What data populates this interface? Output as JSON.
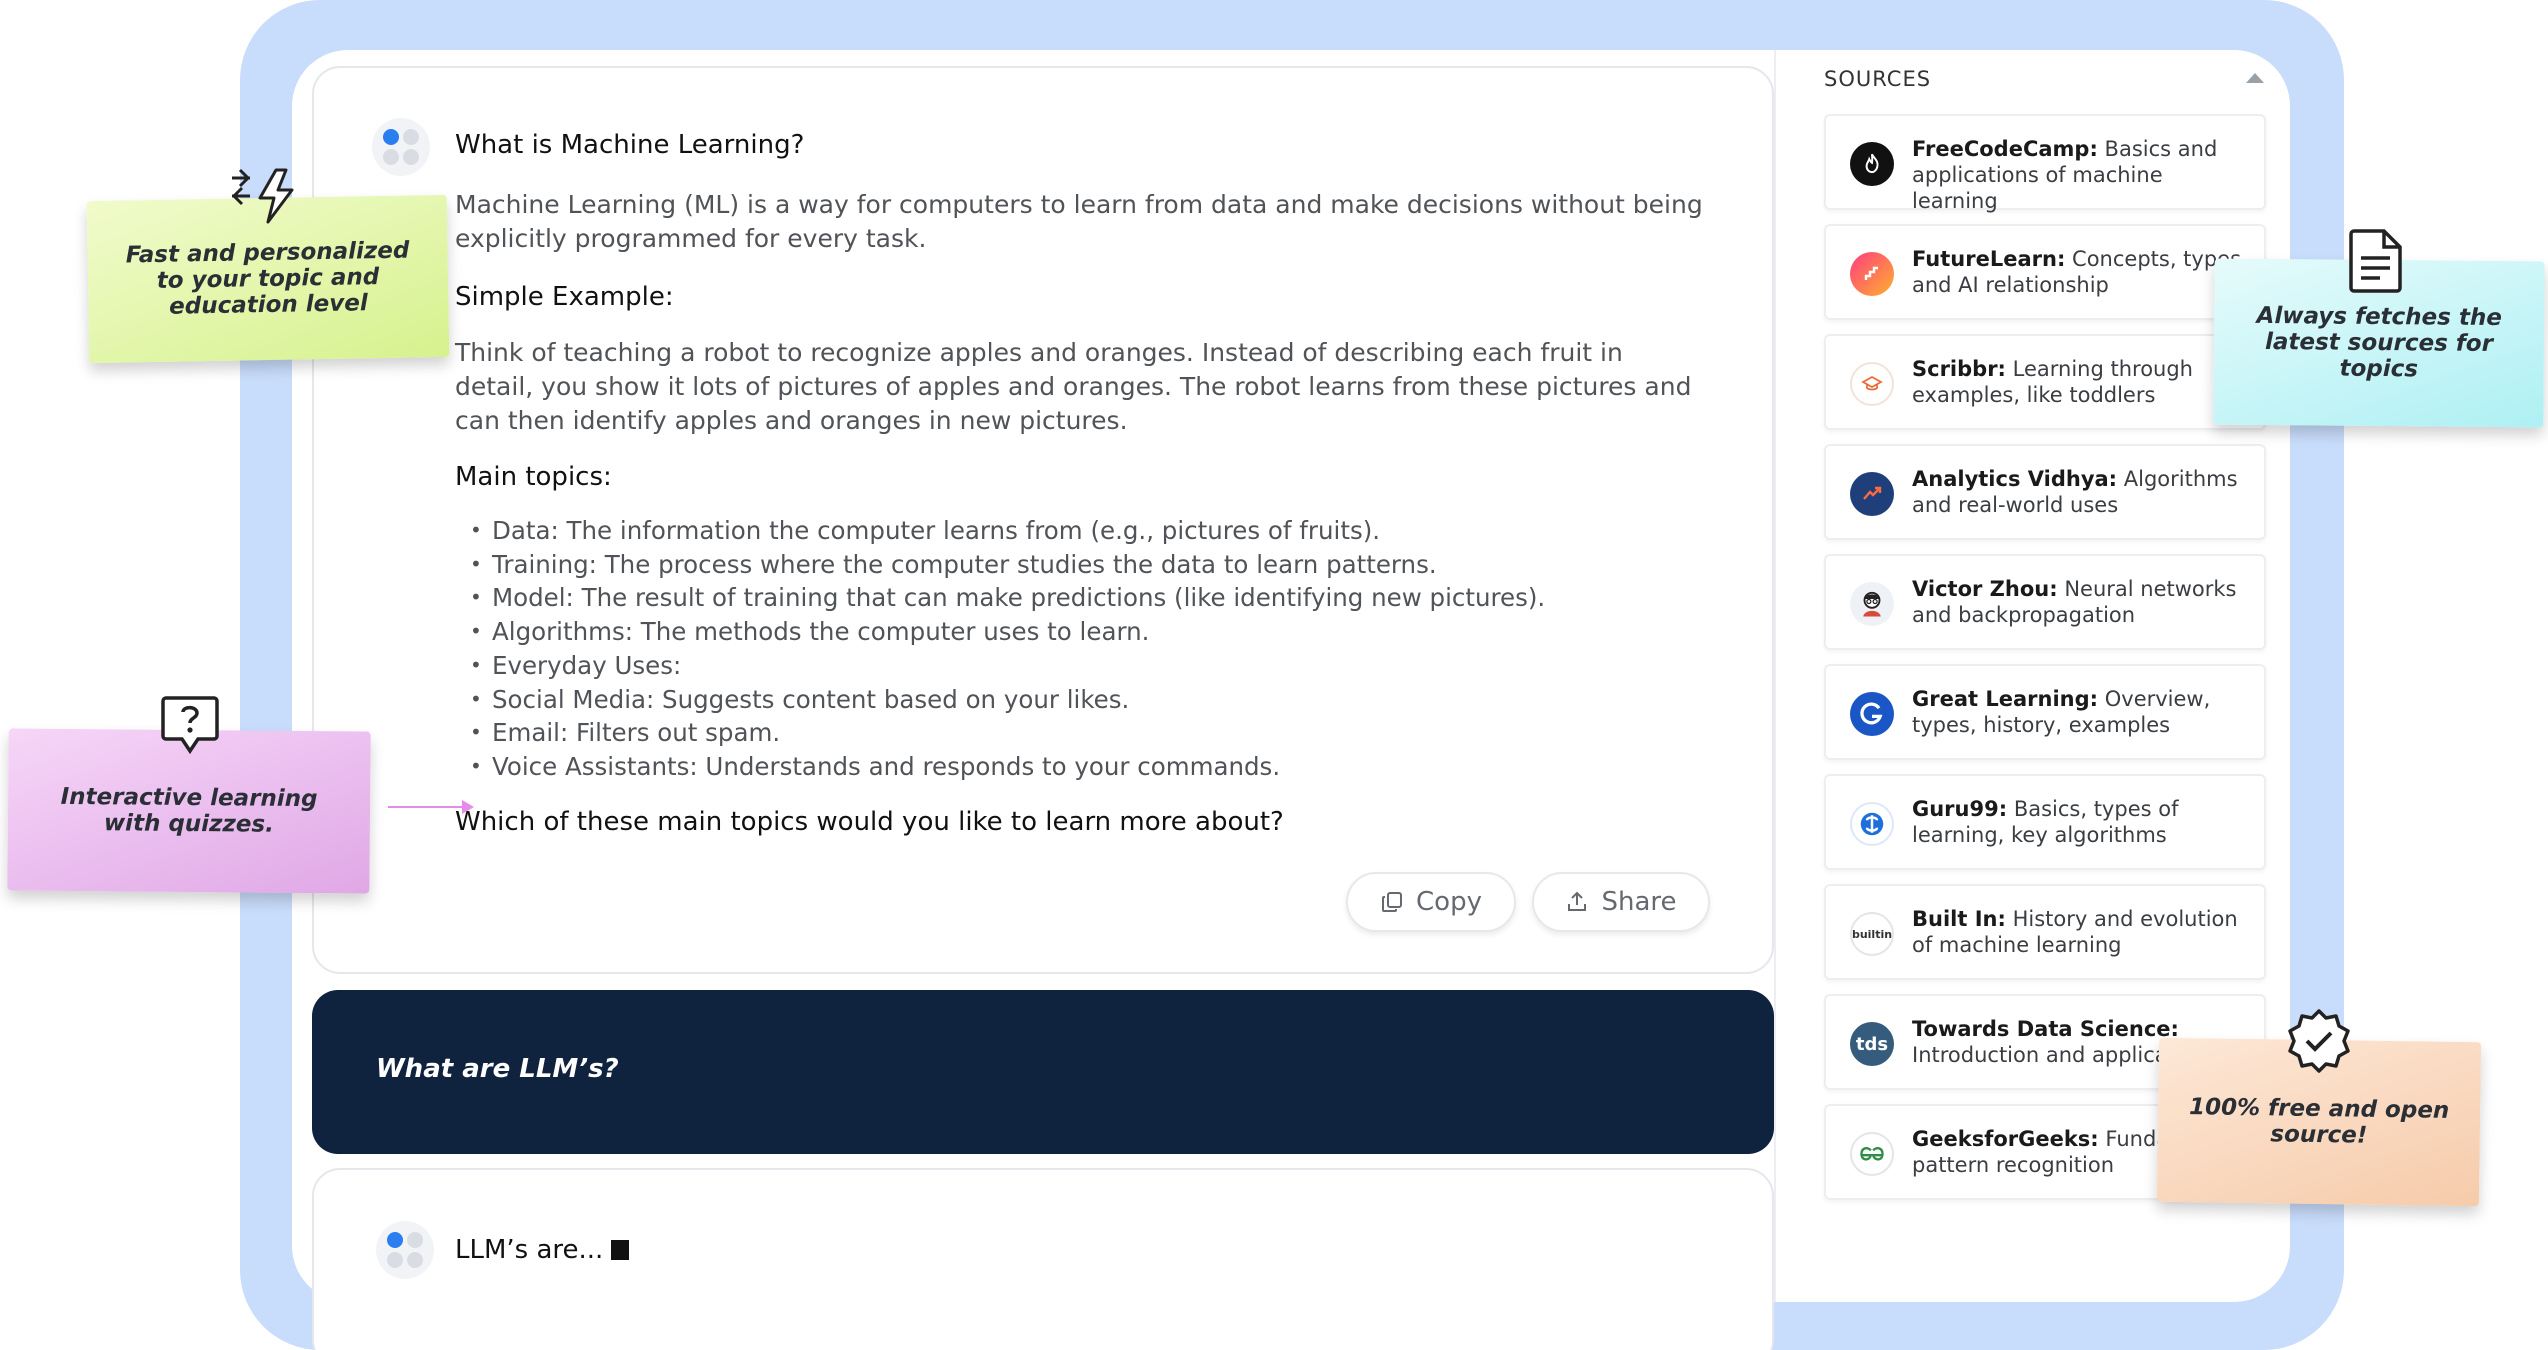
{
  "main": {
    "question": "What is Machine Learning?",
    "intro": "Machine Learning (ML) is a way for computers to learn from data and make decisions without being explicitly programmed for every task.",
    "simple_heading": "Simple Example:",
    "simple_body": "Think of teaching a robot to recognize apples and oranges. Instead of describing each fruit in detail, you show it lots of pictures of apples and oranges. The robot learns from these pictures and can then identify apples and oranges in new pictures.",
    "topics_heading": "Main topics:",
    "topics": [
      "Data: The information the computer learns from (e.g., pictures of fruits).",
      "Training: The process where the computer studies the data to learn patterns.",
      "Model: The result of training that can make predictions (like identifying new pictures).",
      "Algorithms: The methods the computer uses to learn.",
      "Everyday Uses:",
      "Social Media: Suggests content based on your likes.",
      "Email: Filters out spam.",
      "Voice Assistants: Understands and responds to your commands."
    ],
    "follow_up": "Which of these main topics would you like to learn more about?",
    "copy_label": "Copy",
    "share_label": "Share"
  },
  "user_prompt": "What are LLM’s?",
  "streaming_answer": "LLM’s are...",
  "sources": {
    "title": "SOURCES",
    "items": [
      {
        "name": "FreeCodeCamp:",
        "desc": "Basics and applications of machine learning",
        "logo": "flame-icon",
        "color": "#111111"
      },
      {
        "name": "FutureLearn:",
        "desc": "Concepts, types, and AI relationship",
        "logo": "futurelearn-icon",
        "color": "#ff2d8a"
      },
      {
        "name": "Scribbr:",
        "desc": "Learning through examples, like toddlers",
        "logo": "graduation-cap-icon",
        "color": "#ef6a3a"
      },
      {
        "name": "Analytics Vidhya:",
        "desc": "Algorithms and real-world uses",
        "logo": "trend-arrow-icon",
        "color": "#1e3f7a"
      },
      {
        "name": "Victor Zhou:",
        "desc": "Neural networks and backpropagation",
        "logo": "person-avatar-icon",
        "color": "#e9edf2"
      },
      {
        "name": "Great Learning:",
        "desc": "Overview, types, history, examples",
        "logo": "great-learning-icon",
        "color": "#1a56c6"
      },
      {
        "name": "Guru99:",
        "desc": "Basics, types of learning, key algorithms",
        "logo": "guru99-icon",
        "color": "#1e6fd9"
      },
      {
        "name": "Built In:",
        "desc": "History and evolution of machine learning",
        "logo_text": "builtin",
        "color": "#ffffff"
      },
      {
        "name": "Towards Data Science:",
        "desc": "Introduction and applica",
        "logo_text": "tds",
        "color": "#355c7d"
      },
      {
        "name": "GeeksforGeeks:",
        "desc": "Fundam and pattern recognition",
        "logo": "geeks-icon",
        "color": "#ffffff"
      }
    ]
  },
  "notes": {
    "green": "Fast and personalized to your topic and education level",
    "purple": "Interactive learning with quizzes.",
    "cyan": "Always fetches the latest sources for topics",
    "peach": "100% free and open source!"
  }
}
